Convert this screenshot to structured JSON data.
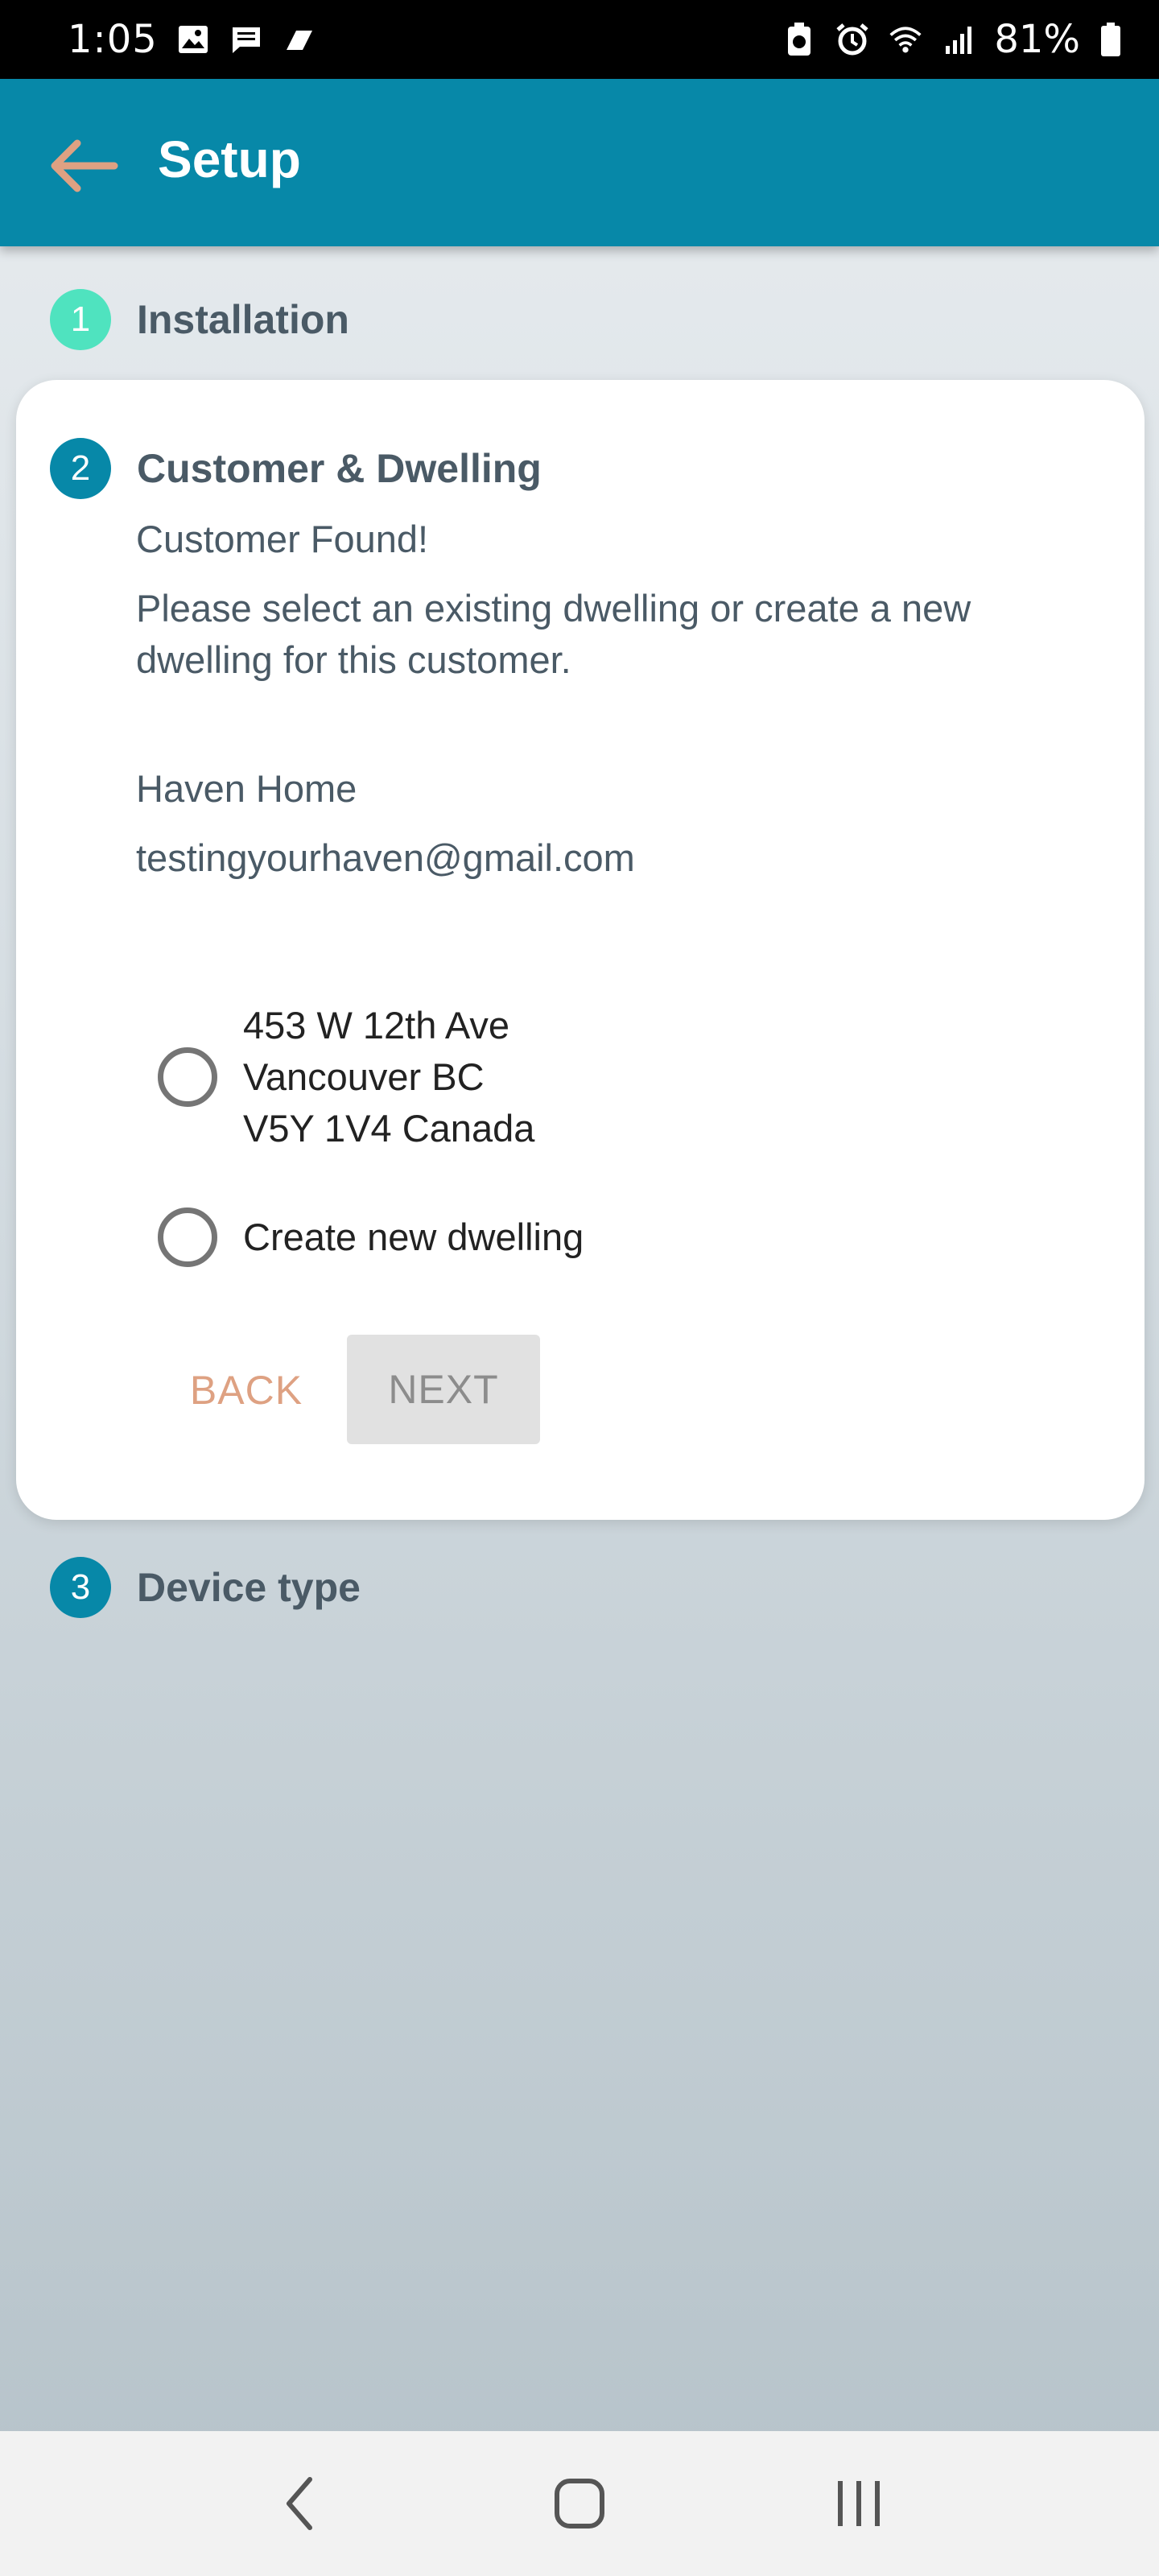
{
  "status_bar": {
    "time": "1:05",
    "battery_percent": "81%",
    "icons_left": [
      "image-icon",
      "message-icon",
      "flag-icon"
    ],
    "icons_right": [
      "battery-saver-icon",
      "alarm-icon",
      "wifi-icon",
      "signal-icon",
      "battery-icon"
    ]
  },
  "app_bar": {
    "title": "Setup",
    "background_color": "#0788a8",
    "back_arrow_color": "#dea182"
  },
  "steps": [
    {
      "number": "1",
      "label": "Installation",
      "state": "completed"
    },
    {
      "number": "2",
      "label": "Customer & Dwelling",
      "state": "active"
    },
    {
      "number": "3",
      "label": "Device type",
      "state": "pending"
    }
  ],
  "customer_step": {
    "heading": "Customer Found!",
    "instruction": "Please select an existing dwelling or create a new dwelling for this customer.",
    "customer_name": "Haven Home",
    "customer_email": "testingyourhaven@gmail.com",
    "dwelling_options": [
      {
        "address_lines": [
          "453 W 12th Ave",
          "Vancouver BC",
          "V5Y 1V4 Canada"
        ],
        "selected": false
      },
      {
        "label": "Create new dwelling",
        "selected": false
      }
    ],
    "back_label": "BACK",
    "next_label": "NEXT",
    "next_enabled": false
  },
  "colors": {
    "accent": "#0788a8",
    "completed_step": "#4fe3bf",
    "back_button": "#dea182"
  },
  "nav_bar": {
    "buttons": [
      "back-nav-icon",
      "home-nav-icon",
      "recents-nav-icon"
    ]
  }
}
